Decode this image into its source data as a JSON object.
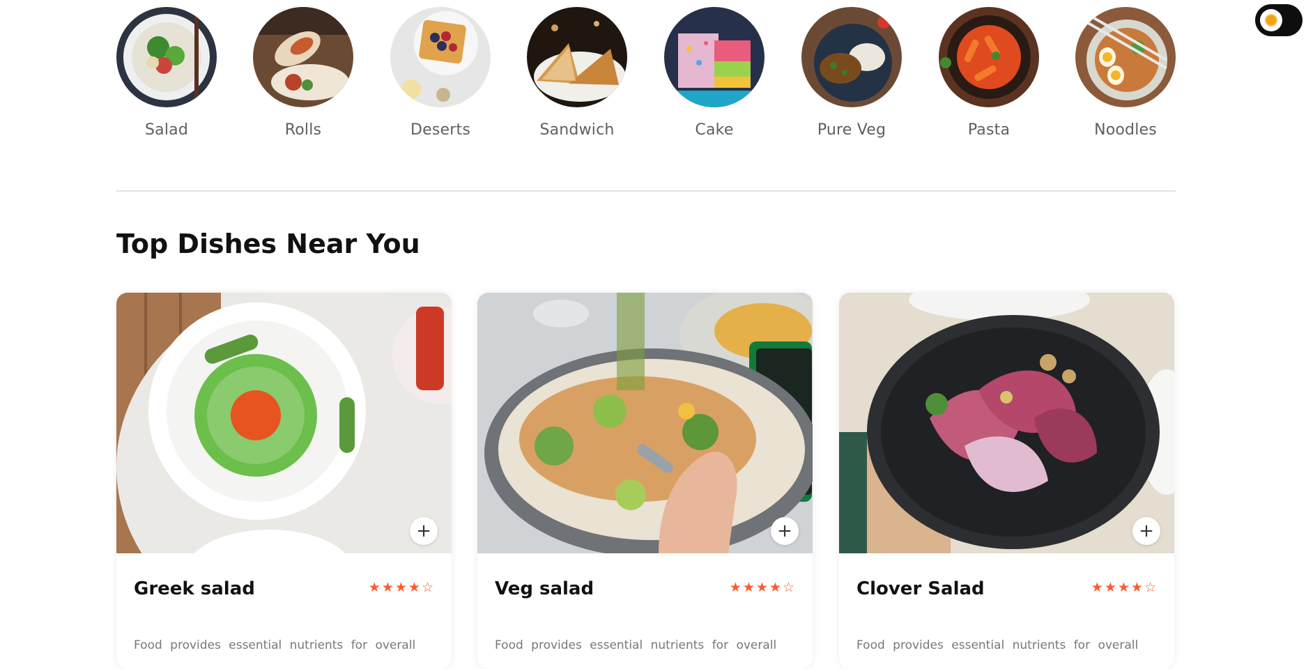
{
  "theme_toggle": {
    "icon": "sun-icon"
  },
  "categories": [
    {
      "label": "Salad"
    },
    {
      "label": "Rolls"
    },
    {
      "label": "Deserts"
    },
    {
      "label": "Sandwich"
    },
    {
      "label": "Cake"
    },
    {
      "label": "Pure Veg"
    },
    {
      "label": "Pasta"
    },
    {
      "label": "Noodles"
    }
  ],
  "section": {
    "title": "Top Dishes Near You"
  },
  "dishes": [
    {
      "name": "Greek salad",
      "rating": 4,
      "max_rating": 5,
      "add_label": "+",
      "description": "Food provides essential nutrients for overall"
    },
    {
      "name": "Veg salad",
      "rating": 4,
      "max_rating": 5,
      "add_label": "+",
      "description": "Food provides essential nutrients for overall"
    },
    {
      "name": "Clover Salad",
      "rating": 4,
      "max_rating": 5,
      "add_label": "+",
      "description": "Food provides essential nutrients for overall"
    }
  ],
  "colors": {
    "accent": "#ff5a2c",
    "toggle_bg": "#0e0e0e",
    "sun": "#f3a316"
  }
}
